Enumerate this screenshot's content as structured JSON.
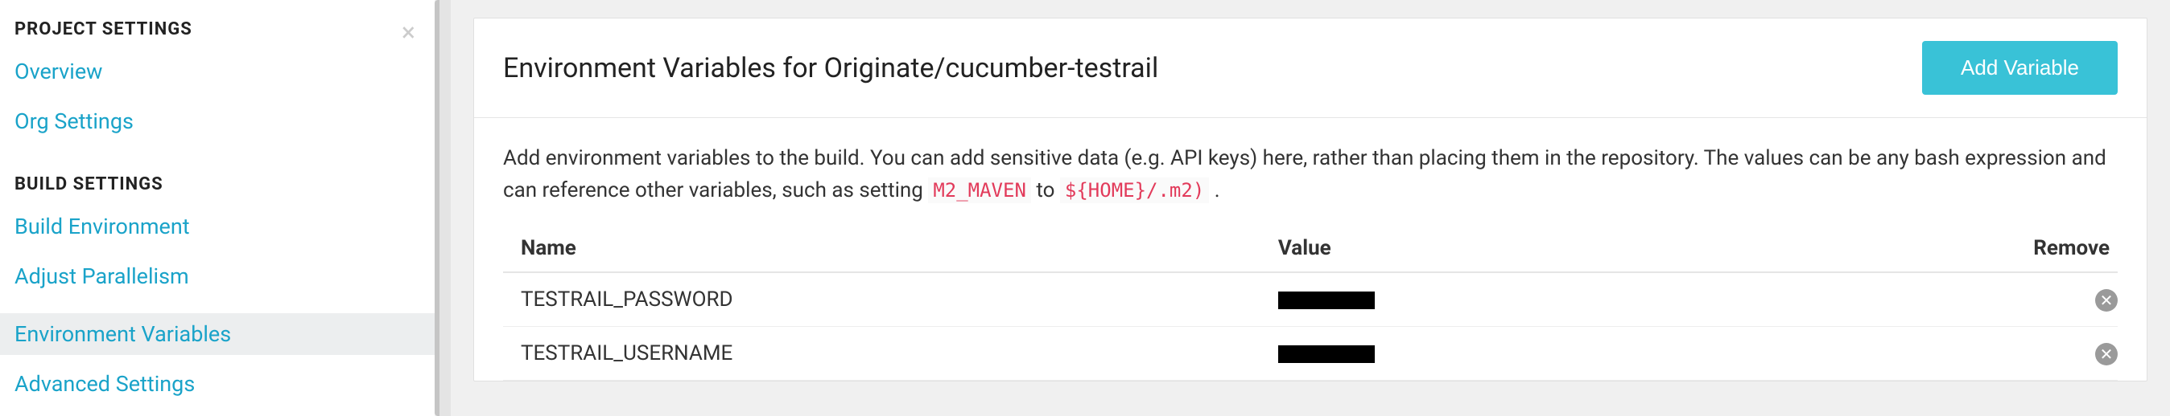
{
  "sidebar": {
    "close_label": "×",
    "sections": [
      {
        "title": "PROJECT SETTINGS",
        "items": [
          {
            "label": "Overview",
            "active": false
          },
          {
            "label": "Org Settings",
            "active": false
          }
        ]
      },
      {
        "title": "BUILD SETTINGS",
        "items": [
          {
            "label": "Build Environment",
            "active": false
          },
          {
            "label": "Adjust Parallelism",
            "active": false
          },
          {
            "label": "Environment Variables",
            "active": true
          },
          {
            "label": "Advanced Settings",
            "active": false
          }
        ]
      }
    ]
  },
  "main": {
    "title": "Environment Variables for Originate/cucumber-testrail",
    "add_button_label": "Add Variable",
    "description_prefix": "Add environment variables to the build. You can add sensitive data (e.g. API keys) here, rather than placing them in the repository. The values can be any bash expression and can reference other variables, such as setting ",
    "desc_code1": "M2_MAVEN",
    "desc_mid": " to ",
    "desc_code2": "${HOME}/.m2)",
    "desc_tail": " .",
    "columns": {
      "name": "Name",
      "value": "Value",
      "remove": "Remove"
    },
    "rows": [
      {
        "name": "TESTRAIL_PASSWORD",
        "value_redacted": true
      },
      {
        "name": "TESTRAIL_USERNAME",
        "value_redacted": true
      }
    ],
    "remove_icon_glyph": "✕"
  }
}
